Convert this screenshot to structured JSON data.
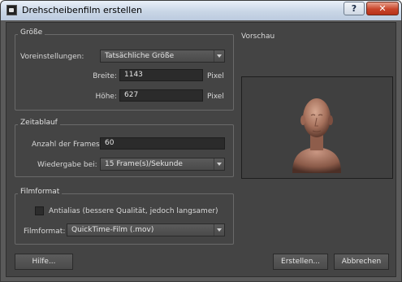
{
  "window": {
    "title": "Drehscheibenfilm erstellen",
    "help_glyph": "?",
    "close_glyph": "✕"
  },
  "size_group": {
    "label": "Größe",
    "preset_label": "Voreinstellungen:",
    "preset_value": "Tatsächliche Größe",
    "width_label": "Breite:",
    "width_value": "1143",
    "width_unit": "Pixel",
    "height_label": "Höhe:",
    "height_value": "627",
    "height_unit": "Pixel"
  },
  "timing_group": {
    "label": "Zeitablauf",
    "frames_label": "Anzahl der Frames:",
    "frames_value": "60",
    "playback_label": "Wiedergabe bei:",
    "playback_value": "15 Frame(s)/Sekunde"
  },
  "format_group": {
    "label": "Filmformat",
    "antialias_label": "Antialias (bessere Qualität, jedoch langsamer)",
    "antialias_checked": false,
    "format_label": "Filmformat:",
    "format_value": "QuickTime-Film (.mov)"
  },
  "preview": {
    "label": "Vorschau",
    "subject": "head-bust-model"
  },
  "buttons": {
    "help": "Hilfe...",
    "create": "Erstellen...",
    "cancel": "Abbrechen"
  }
}
